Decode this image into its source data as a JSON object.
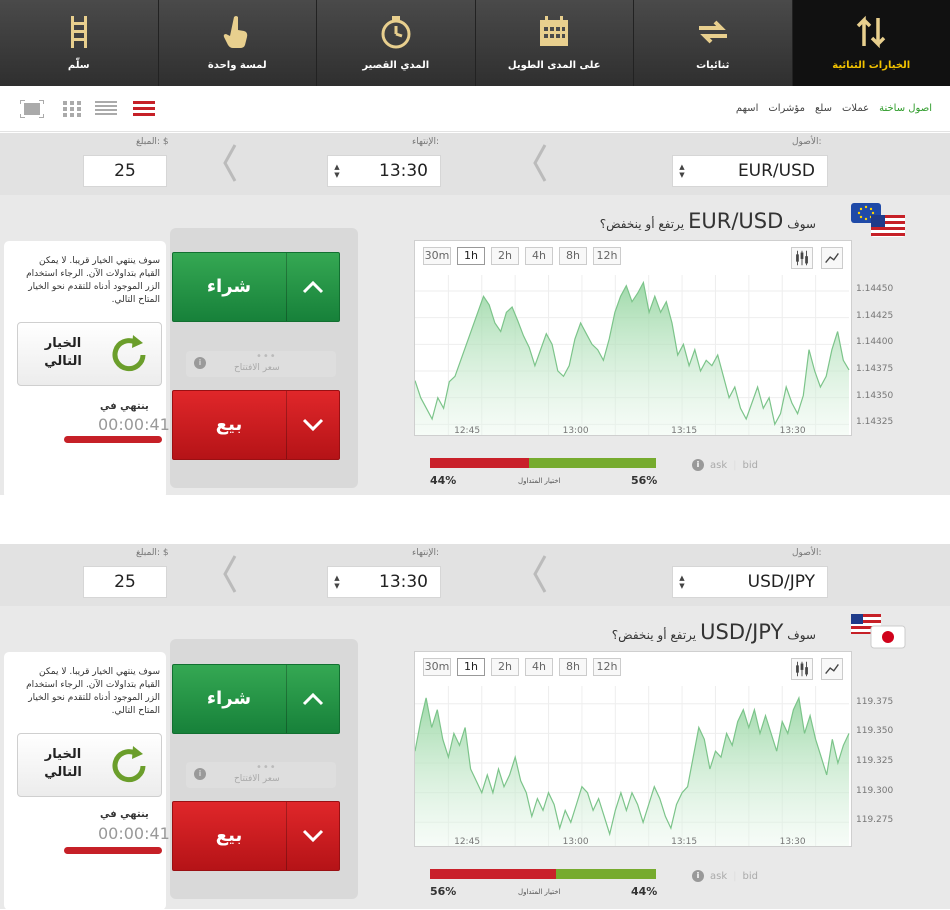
{
  "nav": {
    "tabs": [
      {
        "label": "سلّم",
        "icon": "ladder-icon"
      },
      {
        "label": "لمسة واحدة",
        "icon": "hand-pointer-icon"
      },
      {
        "label": "المدي القصير",
        "icon": "stopwatch-icon"
      },
      {
        "label": "على المدى الطويل",
        "icon": "calendar-icon"
      },
      {
        "label": "ثنائيات",
        "icon": "swap-arrows-icon"
      },
      {
        "label": "الخيارات الثنائية",
        "icon": "up-down-arrows-icon",
        "active": true
      }
    ]
  },
  "filters": [
    "اصول ساخنة",
    "عملات",
    "سلع",
    "مؤشرات",
    "اسهم"
  ],
  "labels": {
    "asset": "الأصول:",
    "expiry": "الإنتهاء:",
    "amount": "المبلغ: $",
    "question_pre": "سوف",
    "question_post": "يرتفع أو ينخفض؟",
    "buy": "شراء",
    "sell": "بيع",
    "next_option": "الخيار التالي",
    "expires_in": "ينتهي في",
    "open_price": "سعر الافتتاح",
    "sentiment": "اختيار المتداول",
    "ask": "ask",
    "bid": "bid",
    "notice": "سوف ينتهي الخيار قريبا. لا يمكن القيام بتداولات الآن. الرجاء استخدام الزر الموجود أدناه للتقدم نحو الخيار المتاح التالي.",
    "open_dots": "•••",
    "info": "i"
  },
  "timeframes": [
    "30m",
    "1h",
    "2h",
    "4h",
    "8h",
    "12h"
  ],
  "active_timeframe": "1h",
  "colors": {
    "buy": "#1f8f44",
    "sell": "#c81a1e",
    "accent": "#f2c200",
    "filter_active": "#2e9b2a",
    "chart_line": "#8fd39b"
  },
  "panels": [
    {
      "asset": "EUR/USD",
      "expiry": "13:30",
      "amount": "25",
      "countdown": "00:00:41",
      "sentiment_red": "44%",
      "sentiment_green": "56%",
      "chart_data": {
        "type": "area",
        "x_ticks": [
          "12:45",
          "13:00",
          "13:15",
          "13:30"
        ],
        "y_ticks": [
          "1.14450",
          "1.14425",
          "1.14400",
          "1.14375",
          "1.14350",
          "1.14325"
        ],
        "ylim": [
          1.14315,
          1.14465
        ],
        "values": [
          1.14366,
          1.1435,
          1.1434,
          1.1433,
          1.1435,
          1.1434,
          1.14365,
          1.1437,
          1.14385,
          1.144,
          1.14415,
          1.1443,
          1.14445,
          1.14437,
          1.1442,
          1.14412,
          1.1443,
          1.14435,
          1.14422,
          1.14408,
          1.14397,
          1.1438,
          1.14395,
          1.1441,
          1.144,
          1.14375,
          1.1437,
          1.1438,
          1.14405,
          1.1442,
          1.1441,
          1.144,
          1.14395,
          1.14385,
          1.14405,
          1.1443,
          1.14445,
          1.14455,
          1.1444,
          1.14448,
          1.14458,
          1.1443,
          1.14445,
          1.1443,
          1.1444,
          1.1442,
          1.1439,
          1.144,
          1.1438,
          1.14395,
          1.14375,
          1.14385,
          1.1438,
          1.1439,
          1.1437,
          1.1435,
          1.1436,
          1.1434,
          1.1433,
          1.14345,
          1.1436,
          1.1434,
          1.1435,
          1.14325,
          1.14335,
          1.1436,
          1.14345,
          1.14335,
          1.14352,
          1.14395,
          1.14375,
          1.1436,
          1.1437,
          1.14395,
          1.14412,
          1.14385,
          1.14376
        ]
      }
    },
    {
      "asset": "USD/JPY",
      "expiry": "13:30",
      "amount": "25",
      "countdown": "00:00:41",
      "sentiment_red": "56%",
      "sentiment_green": "44%",
      "chart_data": {
        "type": "area",
        "x_ticks": [
          "12:45",
          "13:00",
          "13:15",
          "13:30"
        ],
        "y_ticks": [
          "119.375",
          "119.350",
          "119.325",
          "119.300",
          "119.275"
        ],
        "ylim": [
          119.255,
          119.39
        ],
        "values": [
          119.335,
          119.36,
          119.38,
          119.355,
          119.37,
          119.345,
          119.33,
          119.35,
          119.34,
          119.355,
          119.32,
          119.31,
          119.3,
          119.315,
          119.3,
          119.32,
          119.305,
          119.315,
          119.33,
          119.31,
          119.3,
          119.28,
          119.295,
          119.285,
          119.3,
          119.29,
          119.27,
          119.285,
          119.275,
          119.29,
          119.305,
          119.3,
          119.285,
          119.295,
          119.28,
          119.265,
          119.285,
          119.3,
          119.285,
          119.3,
          119.29,
          119.275,
          119.29,
          119.305,
          119.295,
          119.28,
          119.27,
          119.29,
          119.3,
          119.305,
          119.33,
          119.355,
          119.345,
          119.32,
          119.335,
          119.33,
          119.35,
          119.34,
          119.36,
          119.37,
          119.355,
          119.37,
          119.35,
          119.365,
          119.35,
          119.335,
          119.36,
          119.35,
          119.37,
          119.38,
          119.35,
          119.365,
          119.345,
          119.33,
          119.315,
          119.345,
          119.325,
          119.34,
          119.35
        ]
      }
    }
  ]
}
